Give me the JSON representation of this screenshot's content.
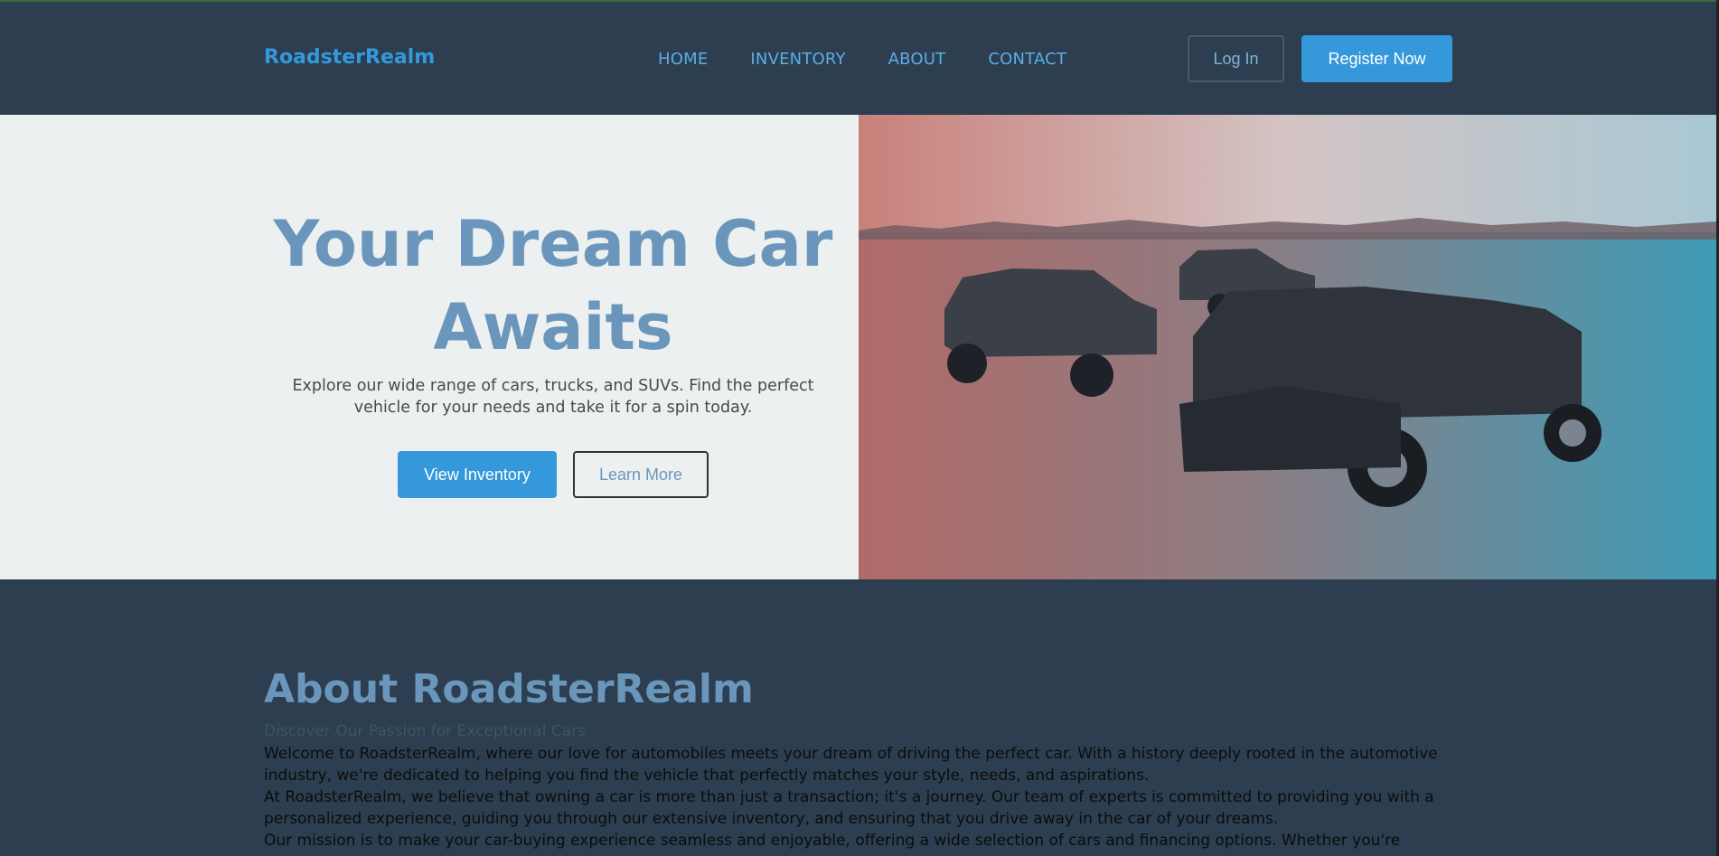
{
  "navbar": {
    "brand": "RoadsterRealm",
    "links": [
      "HOME",
      "INVENTORY",
      "ABOUT",
      "CONTACT"
    ],
    "login_label": "Log In",
    "register_label": "Register Now"
  },
  "hero": {
    "title": "Your Dream Car Awaits",
    "description": "Explore our wide range of cars, trucks, and SUVs. Find the perfect vehicle for your needs and take it for a spin today.",
    "view_inventory_label": "View Inventory",
    "learn_more_label": "Learn More",
    "image": "cars-hero-image"
  },
  "about": {
    "title": "About RoadsterRealm",
    "subtitle": "Discover Our Passion for Exceptional Cars",
    "paragraphs": [
      "Welcome to RoadsterRealm, where our love for automobiles meets your dream of driving the perfect car. With a history deeply rooted in the automotive industry, we're dedicated to helping you find the vehicle that perfectly matches your style, needs, and aspirations.",
      "At RoadsterRealm, we believe that owning a car is more than just a transaction; it's a journey. Our team of experts is committed to providing you with a personalized experience, guiding you through our extensive inventory, and ensuring that you drive away in the car of your dreams.",
      "Our mission is to make your car-buying experience seamless and enjoyable, offering a wide selection of cars and financing options. Whether you're"
    ]
  },
  "colors": {
    "navbar_bg": "#2c3e50",
    "accent": "#3498db",
    "hero_bg": "#ecf0f1",
    "heading": "#6b96bb"
  }
}
